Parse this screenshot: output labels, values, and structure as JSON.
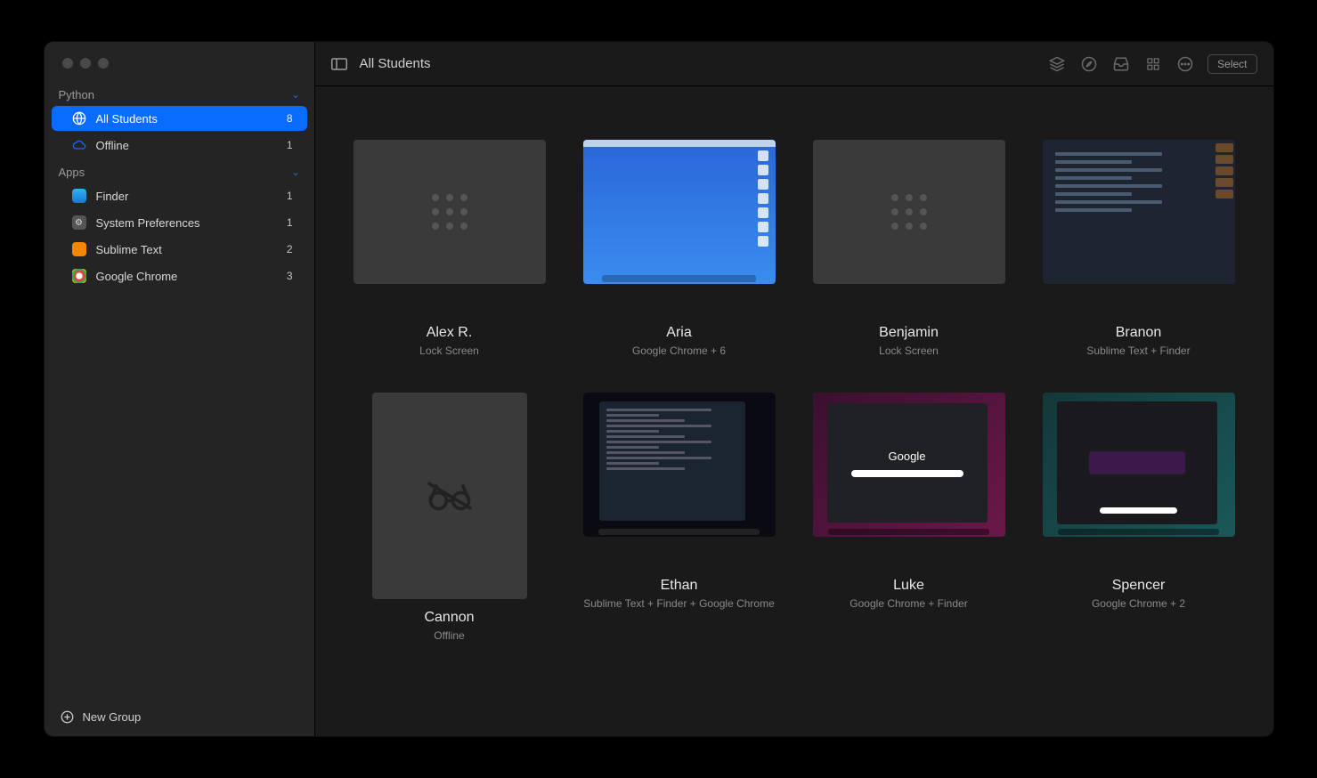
{
  "sidebar": {
    "sections": [
      {
        "title": "Python",
        "items": [
          {
            "icon": "globe",
            "label": "All Students",
            "count": "8",
            "active": true
          },
          {
            "icon": "cloud-off",
            "label": "Offline",
            "count": "1"
          }
        ]
      },
      {
        "title": "Apps",
        "items": [
          {
            "icon": "finder",
            "label": "Finder",
            "count": "1"
          },
          {
            "icon": "sysprefs",
            "label": "System Preferences",
            "count": "1"
          },
          {
            "icon": "sublime",
            "label": "Sublime Text",
            "count": "2"
          },
          {
            "icon": "chrome",
            "label": "Google Chrome",
            "count": "3"
          }
        ]
      }
    ],
    "footer": "New Group"
  },
  "toolbar": {
    "title": "All Students",
    "select": "Select"
  },
  "students": [
    {
      "name": "Alex R.",
      "status": "Lock Screen",
      "thumb": "lock"
    },
    {
      "name": "Aria",
      "status": "Google Chrome + 6",
      "thumb": "blue"
    },
    {
      "name": "Benjamin",
      "status": "Lock Screen",
      "thumb": "lock"
    },
    {
      "name": "Branon",
      "status": "Sublime Text + Finder",
      "thumb": "code"
    },
    {
      "name": "Cannon",
      "status": "Offline",
      "thumb": "offline"
    },
    {
      "name": "Ethan",
      "status": "Sublime Text + Finder + Google Chrome",
      "thumb": "term"
    },
    {
      "name": "Luke",
      "status": "Google Chrome + Finder",
      "thumb": "google"
    },
    {
      "name": "Spencer",
      "status": "Google Chrome + 2",
      "thumb": "spencer"
    }
  ]
}
